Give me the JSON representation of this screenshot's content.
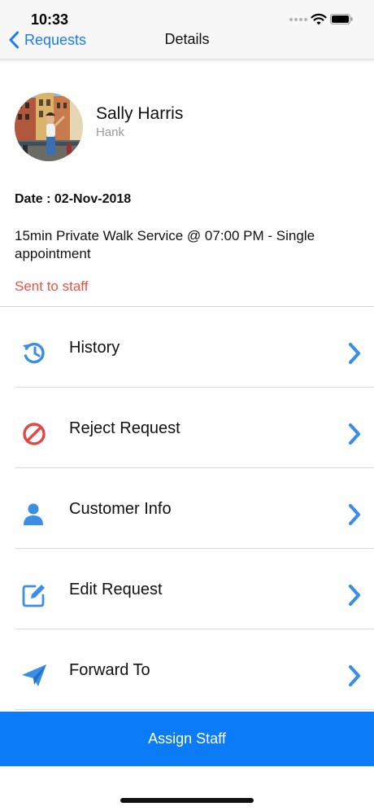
{
  "status_bar": {
    "time": "10:33"
  },
  "nav": {
    "back_label": "Requests",
    "title": "Details"
  },
  "profile": {
    "name": "Sally Harris",
    "subtitle": "Hank"
  },
  "request": {
    "date": "Date : 02-Nov-2018",
    "service": "15min Private Walk Service @ 07:00 PM - Single appointment",
    "status": "Sent to staff"
  },
  "menu": {
    "items": [
      {
        "label": "History",
        "icon": "history-icon"
      },
      {
        "label": "Reject Request",
        "icon": "block-icon"
      },
      {
        "label": "Customer Info",
        "icon": "user-icon"
      },
      {
        "label": "Edit Request",
        "icon": "edit-icon"
      },
      {
        "label": "Forward To",
        "icon": "paper-plane-icon"
      }
    ]
  },
  "actions": {
    "assign_label": "Assign Staff"
  },
  "colors": {
    "accent": "#0b7bf8",
    "link": "#1a7cf6",
    "status": "#e8534a",
    "reject": "#e04848",
    "icon_blue": "#3a8ee6"
  }
}
